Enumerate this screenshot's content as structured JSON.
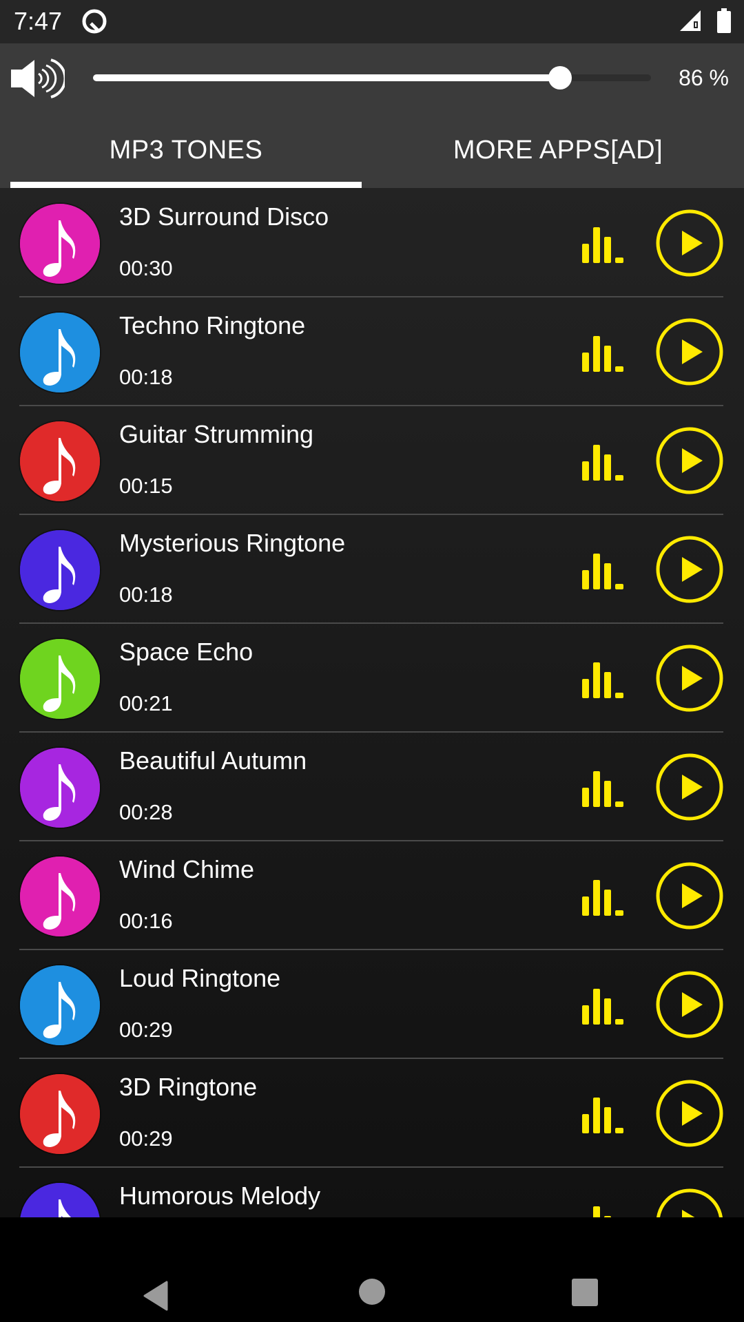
{
  "status_bar": {
    "time": "7:47",
    "icons": [
      "q-notification-icon",
      "signal-icon",
      "battery-icon"
    ]
  },
  "volume": {
    "icon": "speaker-icon",
    "level_percent": 86,
    "label": "86 %"
  },
  "tabs": [
    {
      "label": "MP3 TONES",
      "selected": true
    },
    {
      "label": "MORE APPS[AD]",
      "selected": false
    }
  ],
  "accent_color": "#ffea00",
  "ringtones": [
    {
      "title": "3D Surround Disco",
      "duration": "00:30",
      "color": "#e020b0"
    },
    {
      "title": "Techno Ringtone",
      "duration": "00:18",
      "color": "#1e8fe0"
    },
    {
      "title": "Guitar Strumming",
      "duration": "00:15",
      "color": "#e02a2a"
    },
    {
      "title": "Mysterious Ringtone",
      "duration": "00:18",
      "color": "#4a28e0"
    },
    {
      "title": "Space Echo",
      "duration": "00:21",
      "color": "#6fd41f"
    },
    {
      "title": "Beautiful Autumn",
      "duration": "00:28",
      "color": "#a726e0"
    },
    {
      "title": "Wind Chime",
      "duration": "00:16",
      "color": "#e020b0"
    },
    {
      "title": "Loud Ringtone",
      "duration": "00:29",
      "color": "#1e8fe0"
    },
    {
      "title": "3D Ringtone",
      "duration": "00:29",
      "color": "#e02a2a"
    },
    {
      "title": "Humorous Melody",
      "duration": "",
      "color": "#4a28e0"
    }
  ],
  "nav_bar": {
    "back": "back-icon",
    "home": "home-icon",
    "recents": "recents-icon"
  }
}
